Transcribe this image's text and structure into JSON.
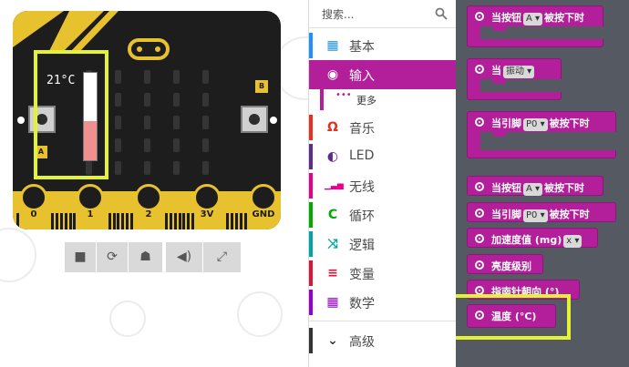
{
  "simulator": {
    "temperature_text": "21°C",
    "thermometer_level": 0.45,
    "button_a_tag": "A",
    "button_b_tag": "B",
    "pins": [
      "0",
      "1",
      "2",
      "3V",
      "GND"
    ],
    "controls": [
      "stop-icon",
      "restart-icon",
      "debug-icon",
      "mute-icon",
      "fullscreen-icon"
    ],
    "colors": {
      "board": "#1d1d1d",
      "accent": "#e8c12e",
      "highlight": "#e3f234"
    }
  },
  "sidebar": {
    "search_placeholder": "搜索...",
    "categories": [
      {
        "label": "基本",
        "icon": "grid-icon",
        "color": "#1e90ff"
      },
      {
        "label": "输入",
        "icon": "radio-icon",
        "color": "#b31f9a"
      },
      {
        "label": "更多",
        "icon": "dots-icon",
        "color": "#b31f9a"
      },
      {
        "label": "音乐",
        "icon": "headphones-icon",
        "color": "#e63022"
      },
      {
        "label": "LED",
        "icon": "toggle-icon",
        "color": "#5c2d91"
      },
      {
        "label": "无线",
        "icon": "signal-icon",
        "color": "#e3008c"
      },
      {
        "label": "循环",
        "icon": "loop-icon",
        "color": "#00aa00"
      },
      {
        "label": "逻辑",
        "icon": "shuffle-icon",
        "color": "#00a4a6"
      },
      {
        "label": "变量",
        "icon": "lines-icon",
        "color": "#dc143c"
      },
      {
        "label": "数学",
        "icon": "calculator-icon",
        "color": "#9400d3"
      },
      {
        "label": "高级",
        "icon": "chevron-down-icon",
        "color": "#333333"
      }
    ]
  },
  "blocks": [
    {
      "prefix": "当按钮",
      "dropdown": "A ▾",
      "suffix": "被按下时"
    },
    {
      "prefix": "当",
      "dropdown": "振动 ▾",
      "suffix": ""
    },
    {
      "prefix": "当引脚",
      "dropdown": "P0 ▾",
      "suffix": "被按下时"
    },
    {
      "prefix": "当按钮",
      "dropdown": "A ▾",
      "suffix": "被按下时"
    },
    {
      "prefix": "当引脚",
      "dropdown": "P0 ▾",
      "suffix": "被按下时"
    },
    {
      "prefix": "加速度值 (mg)",
      "dropdown": "x ▾",
      "suffix": ""
    },
    {
      "prefix": "亮度级别",
      "dropdown": "",
      "suffix": ""
    },
    {
      "prefix": "指南针朝向 (°)",
      "dropdown": "",
      "suffix": ""
    },
    {
      "prefix": "温度 (°C)",
      "dropdown": "",
      "suffix": ""
    }
  ]
}
